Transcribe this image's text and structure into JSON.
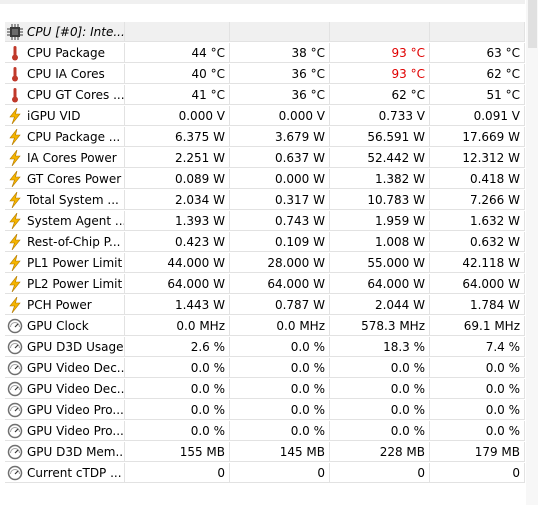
{
  "group": {
    "label": "CPU [#0]: Inte..."
  },
  "rows": [
    {
      "label": "CPU Package",
      "icon": "thermometer-icon",
      "current": "44 °C",
      "min": "38 °C",
      "max": "93 °C",
      "avg": "63 °C",
      "max_alert": true
    },
    {
      "label": "CPU IA Cores",
      "icon": "thermometer-icon",
      "current": "40 °C",
      "min": "36 °C",
      "max": "93 °C",
      "avg": "62 °C",
      "max_alert": true
    },
    {
      "label": "CPU GT Cores ...",
      "icon": "thermometer-icon",
      "current": "41 °C",
      "min": "36 °C",
      "max": "62 °C",
      "avg": "51 °C",
      "max_alert": false
    },
    {
      "label": "iGPU VID",
      "icon": "lightning-icon",
      "current": "0.000 V",
      "min": "0.000 V",
      "max": "0.733 V",
      "avg": "0.091 V",
      "max_alert": false
    },
    {
      "label": "CPU Package ...",
      "icon": "lightning-icon",
      "current": "6.375 W",
      "min": "3.679 W",
      "max": "56.591 W",
      "avg": "17.669 W",
      "max_alert": false
    },
    {
      "label": "IA Cores Power",
      "icon": "lightning-icon",
      "current": "2.251 W",
      "min": "0.637 W",
      "max": "52.442 W",
      "avg": "12.312 W",
      "max_alert": false
    },
    {
      "label": "GT Cores Power",
      "icon": "lightning-icon",
      "current": "0.089 W",
      "min": "0.000 W",
      "max": "1.382 W",
      "avg": "0.418 W",
      "max_alert": false
    },
    {
      "label": "Total System ...",
      "icon": "lightning-icon",
      "current": "2.034 W",
      "min": "0.317 W",
      "max": "10.783 W",
      "avg": "7.266 W",
      "max_alert": false
    },
    {
      "label": "System Agent ...",
      "icon": "lightning-icon",
      "current": "1.393 W",
      "min": "0.743 W",
      "max": "1.959 W",
      "avg": "1.632 W",
      "max_alert": false
    },
    {
      "label": "Rest-of-Chip P...",
      "icon": "lightning-icon",
      "current": "0.423 W",
      "min": "0.109 W",
      "max": "1.008 W",
      "avg": "0.632 W",
      "max_alert": false
    },
    {
      "label": "PL1 Power Limit",
      "icon": "lightning-icon",
      "current": "44.000 W",
      "min": "28.000 W",
      "max": "55.000 W",
      "avg": "42.118 W",
      "max_alert": false
    },
    {
      "label": "PL2 Power Limit",
      "icon": "lightning-icon",
      "current": "64.000 W",
      "min": "64.000 W",
      "max": "64.000 W",
      "avg": "64.000 W",
      "max_alert": false
    },
    {
      "label": "PCH Power",
      "icon": "lightning-icon",
      "current": "1.443 W",
      "min": "0.787 W",
      "max": "2.044 W",
      "avg": "1.784 W",
      "max_alert": false
    },
    {
      "label": "GPU Clock",
      "icon": "gauge-icon",
      "current": "0.0 MHz",
      "min": "0.0 MHz",
      "max": "578.3 MHz",
      "avg": "69.1 MHz",
      "max_alert": false
    },
    {
      "label": "GPU D3D Usage",
      "icon": "gauge-icon",
      "current": "2.6 %",
      "min": "0.0 %",
      "max": "18.3 %",
      "avg": "7.4 %",
      "max_alert": false
    },
    {
      "label": "GPU Video Dec...",
      "icon": "gauge-icon",
      "current": "0.0 %",
      "min": "0.0 %",
      "max": "0.0 %",
      "avg": "0.0 %",
      "max_alert": false
    },
    {
      "label": "GPU Video Dec...",
      "icon": "gauge-icon",
      "current": "0.0 %",
      "min": "0.0 %",
      "max": "0.0 %",
      "avg": "0.0 %",
      "max_alert": false
    },
    {
      "label": "GPU Video Pro...",
      "icon": "gauge-icon",
      "current": "0.0 %",
      "min": "0.0 %",
      "max": "0.0 %",
      "avg": "0.0 %",
      "max_alert": false
    },
    {
      "label": "GPU Video Pro...",
      "icon": "gauge-icon",
      "current": "0.0 %",
      "min": "0.0 %",
      "max": "0.0 %",
      "avg": "0.0 %",
      "max_alert": false
    },
    {
      "label": "GPU D3D Mem...",
      "icon": "gauge-icon",
      "current": "155 MB",
      "min": "145 MB",
      "max": "228 MB",
      "avg": "179 MB",
      "max_alert": false
    },
    {
      "label": "Current cTDP ...",
      "icon": "gauge-icon",
      "current": "0",
      "min": "0",
      "max": "0",
      "avg": "0",
      "max_alert": false
    }
  ],
  "colors": {
    "alert": "#e00000",
    "thermo": "#c0392b",
    "bolt": "#f5b400",
    "gauge": "#6f6f6f"
  }
}
